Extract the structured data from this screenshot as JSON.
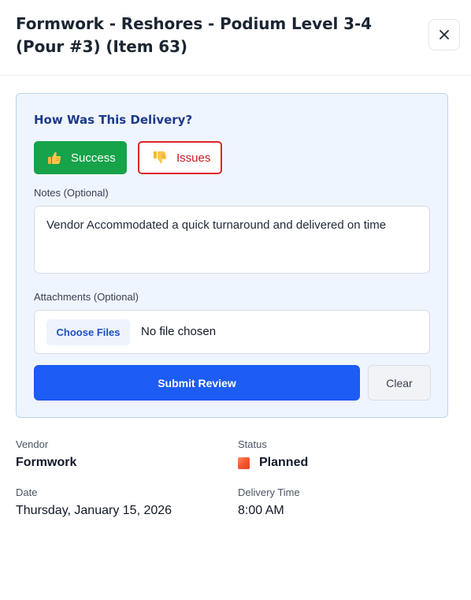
{
  "header": {
    "title": "Formwork - Reshores - Podium Level 3-4 (Pour #3) (Item 63)",
    "close_icon": "close-icon"
  },
  "review": {
    "heading": "How Was This Delivery?",
    "success_label": "Success",
    "success_icon": "thumbs-up-icon",
    "issues_label": "Issues",
    "issues_icon": "thumbs-down-icon",
    "notes_label": "Notes (Optional)",
    "notes_value": "Vendor Accommodated a quick turnaround and delivered on time",
    "attachments_label": "Attachments (Optional)",
    "choose_files_label": "Choose Files",
    "file_status": "No file chosen",
    "submit_label": "Submit Review",
    "clear_label": "Clear"
  },
  "details": {
    "vendor_label": "Vendor",
    "vendor_value": "Formwork",
    "status_label": "Status",
    "status_value": "Planned",
    "status_color": "#f2542d",
    "date_label": "Date",
    "date_value": "Thursday, January 15, 2026",
    "time_label": "Delivery Time",
    "time_value": "8:00 AM"
  },
  "colors": {
    "success": "#16a34a",
    "issues": "#dc2626",
    "primary": "#1d5cf5",
    "panel_bg": "#eff5ff",
    "heading": "#1e3a8a"
  }
}
